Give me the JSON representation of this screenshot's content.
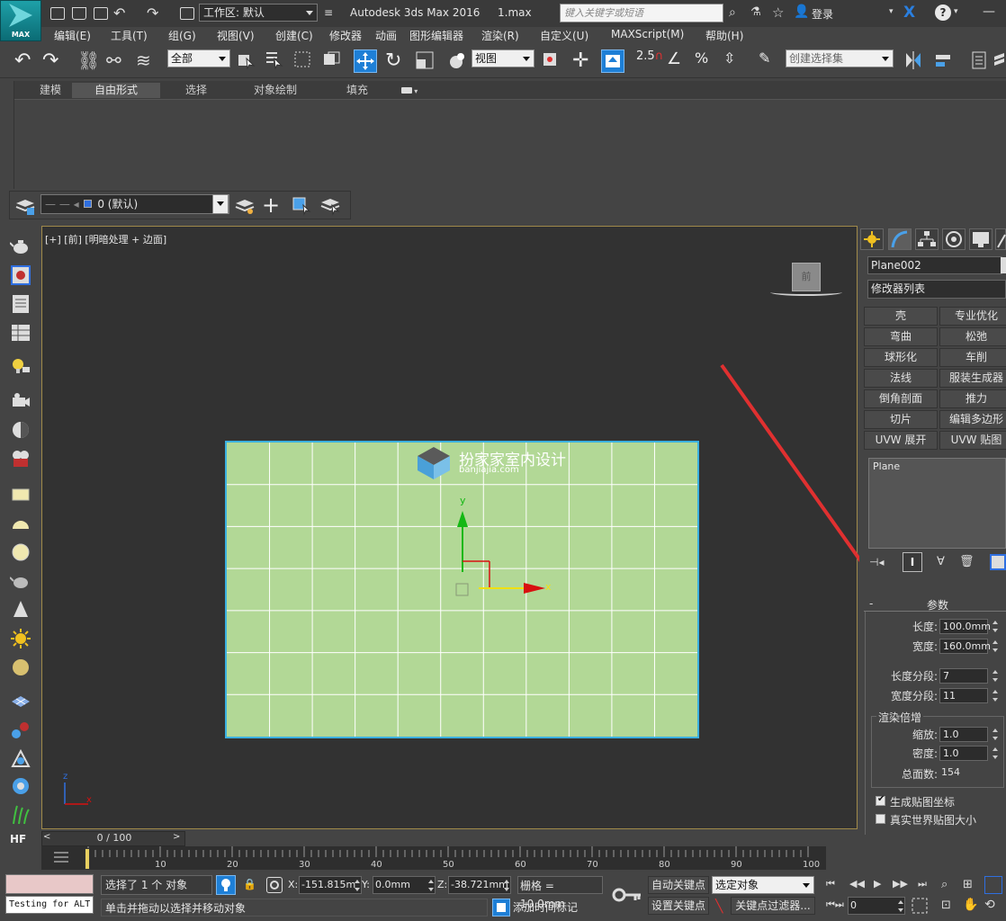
{
  "app": {
    "logo_text": "MAX",
    "workspace_label": "工作区: 默认",
    "title": "Autodesk 3ds Max 2016",
    "filename": "1.max",
    "search_placeholder": "键入关键字或短语",
    "login_label": "登录"
  },
  "menu": [
    "编辑(E)",
    "工具(T)",
    "组(G)",
    "视图(V)",
    "创建(C)",
    "修改器",
    "动画",
    "图形编辑器",
    "渲染(R)",
    "自定义(U)",
    "MAXScript(M)",
    "帮助(H)"
  ],
  "toolbar": {
    "selection_filter": "全部",
    "ref_coord": "视图",
    "snap_value": "2.5",
    "named_selection_placeholder": "创建选择集"
  },
  "ribbon": {
    "tabs": [
      "建模",
      "自由形式",
      "选择",
      "对象绘制",
      "填充"
    ],
    "active_tab": 1
  },
  "layer": {
    "current": "0 (默认)"
  },
  "viewport": {
    "label": "[+] [前] [明暗处理 + 边面]",
    "viewcube_label": "前",
    "axis_y": "y",
    "axis_x": "x",
    "mini_axis_z": "z",
    "mini_axis_x": "x",
    "plane_color": "#b2d896",
    "plane_border": "#3bb0e0",
    "grid_rows": 7,
    "grid_cols": 11,
    "watermark_title": "扮家家室内设计",
    "watermark_sub": "banjiajia.com"
  },
  "timeline": {
    "frame_readout": "0 / 100",
    "ticks": [
      "10",
      "20",
      "30",
      "40",
      "50",
      "60",
      "70",
      "80",
      "90",
      "100"
    ]
  },
  "command_panel": {
    "object_name": "Plane002",
    "modifier_list": "修改器列表",
    "modifier_buttons": [
      "壳",
      "专业优化",
      "弯曲",
      "松弛",
      "球形化",
      "车削",
      "法线",
      "服装生成器",
      "倒角剖面",
      "推力",
      "切片",
      "编辑多边形",
      "UVW 展开",
      "UVW 贴图"
    ],
    "stack_item": "Plane",
    "rollout_toggle": "-",
    "rollout_title": "参数",
    "params": {
      "length_label": "长度:",
      "length_value": "100.0mm",
      "width_label": "宽度:",
      "width_value": "160.0mm",
      "length_segs_label": "长度分段:",
      "length_segs_value": "7",
      "width_segs_label": "宽度分段:",
      "width_segs_value": "11",
      "render_mult_group": "渲染倍增",
      "scale_label": "缩放:",
      "scale_value": "1.0",
      "density_label": "密度:",
      "density_value": "1.0",
      "total_faces_label": "总面数:",
      "total_faces_value": "154",
      "gen_map_coords": "生成贴图坐标",
      "real_world_map": "真实世界贴图大小"
    }
  },
  "status": {
    "maxscript_text": "Testing for ALT",
    "selection_info": "选择了 1 个 对象",
    "prompt": "单击并拖动以选择并移动对象",
    "x_label": "X:",
    "x_value": "-151.815m",
    "y_label": "Y:",
    "y_value": "0.0mm",
    "z_label": "Z:",
    "z_value": "-38.721mm",
    "grid": "栅格 = 10.0mm",
    "add_time_tag": "添加时间标记",
    "auto_key": "自动关键点",
    "set_key": "设置关键点",
    "key_mode": "选定对象",
    "key_filters": "关键点过滤器...",
    "current_frame": "0"
  },
  "colors": {
    "accent_blue": "#1e7fd6",
    "arrow_red": "#e03030",
    "axis_green": "#14b814",
    "axis_red": "#d81010"
  }
}
